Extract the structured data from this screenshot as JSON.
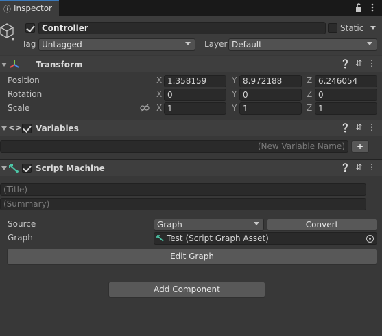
{
  "tab": {
    "title": "Inspector",
    "icon": "info-icon"
  },
  "tab_actions": {
    "lock_icon": "lock-icon",
    "menu_icon": "kebab-menu-icon"
  },
  "object": {
    "active": true,
    "name": "Controller",
    "static_label": "Static",
    "tag_label": "Tag",
    "tag_value": "Untagged",
    "layer_label": "Layer",
    "layer_value": "Default"
  },
  "transform": {
    "title": "Transform",
    "position_label": "Position",
    "rotation_label": "Rotation",
    "scale_label": "Scale",
    "axis_x": "X",
    "axis_y": "Y",
    "axis_z": "Z",
    "position": {
      "x": "1.358159",
      "y": "8.972188",
      "z": "6.246054"
    },
    "rotation": {
      "x": "0",
      "y": "0",
      "z": "0"
    },
    "scale": {
      "x": "1",
      "y": "1",
      "z": "1"
    }
  },
  "variables": {
    "title": "Variables",
    "enabled": true,
    "new_name_placeholder": "(New Variable Name)",
    "add_label": "+"
  },
  "script_machine": {
    "title": "Script Machine",
    "enabled": true,
    "title_placeholder": "(Title)",
    "summary_placeholder": "(Summary)",
    "source_label": "Source",
    "source_value": "Graph",
    "convert_label": "Convert",
    "graph_label": "Graph",
    "graph_value": "Test (Script Graph Asset)",
    "edit_graph_label": "Edit Graph"
  },
  "add_component_label": "Add Component",
  "colors": {
    "background": "#383838",
    "tab_accent": "#3a79bb",
    "header": "#3e3e3e",
    "field": "#2a2a2a",
    "button": "#585858"
  }
}
